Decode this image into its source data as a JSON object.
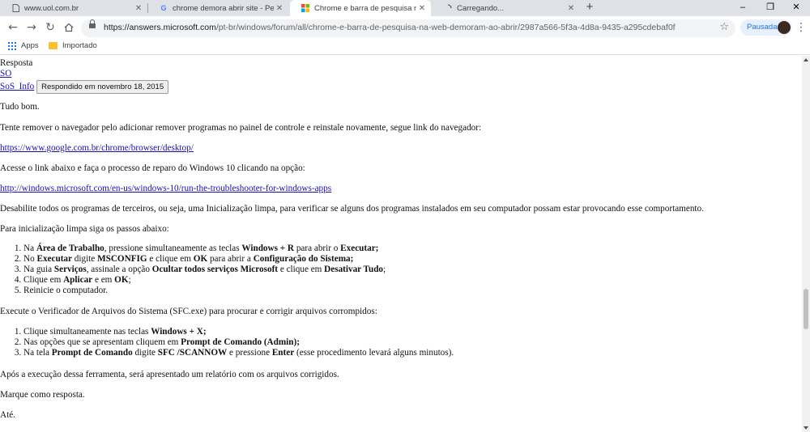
{
  "tabs": [
    {
      "title": "www.uol.com.br",
      "icon": "page-icon"
    },
    {
      "title": "chrome demora abrir site - Pesq",
      "icon": "google-icon"
    },
    {
      "title": "Chrome e barra de pesquisa na W",
      "icon": "microsoft-icon"
    },
    {
      "title": "Carregando...",
      "icon": "loading-icon"
    }
  ],
  "window_controls": {
    "minimize": "–",
    "restore": "❐",
    "close": "✕"
  },
  "toolbar": {
    "url_host": "https://answers.microsoft.com",
    "url_path": "/pt-br/windows/forum/all/chrome-e-barra-de-pesquisa-na-web-demoram-ao-abrir/2987a566-5f3a-4d8a-9435-a295cdebaf0f",
    "profile_label": "Pausada"
  },
  "bookmarks": [
    {
      "label": "Apps",
      "icon": "apps-icon"
    },
    {
      "label": "Importado",
      "icon": "folder-icon"
    }
  ],
  "post": {
    "header": "Resposta",
    "user_link": "SO",
    "user_name": "SoS_Info",
    "answered_button": "Respondido em novembro 18, 2015",
    "greeting": "Tudo bom.",
    "p1": "Tente remover o navegador pelo adicionar remover programas no painel de controle e reinstale novamente, segue link do navegador:",
    "link1": "https://www.google.com.br/chrome/browser/desktop/",
    "p2": "Acesse o link abaixo e faça o processo de reparo do Windows 10 clicando na opção:",
    "link2": "http://windows.microsoft.com/en-us/windows-10/run-the-troubleshooter-for-windows-apps",
    "p3": "Desabilite todos os programas de terceiros, ou seja, uma Inicialização limpa, para verificar se alguns dos programas instalados em seu computador possam estar provocando esse comportamento.",
    "p4": "Para inicialização limpa siga os passos abaixo:",
    "steps1": [
      {
        "a": "Na ",
        "b": "Área de Trabalho",
        "c": ", pressione simultaneamente as teclas ",
        "d": "Windows + R",
        "e": " para abrir o ",
        "f": "Executar;",
        "g": ""
      },
      {
        "a": "No ",
        "b": "Executar",
        "c": " digite ",
        "d": "MSCONFIG",
        "e": " e clique em ",
        "f": "OK",
        "g": " para abrir a ",
        "h": "Configuração do Sistema;"
      },
      {
        "a": "Na guia ",
        "b": "Serviços",
        "c": ", assinale a opção ",
        "d": "Ocultar todos serviços Microsoft",
        "e": " e clique em ",
        "f": "Desativar Tudo",
        "g": ";"
      },
      {
        "a": "Clique em ",
        "b": "Aplicar",
        "c": " e em ",
        "d": "OK",
        "e": ";"
      },
      {
        "a": "Reinicie o computador."
      }
    ],
    "p5": "Execute o Verificador de Arquivos do Sistema (SFC.exe) para procurar e corrigir arquivos corrompidos:",
    "steps2": [
      {
        "a": "Clique simultaneamente nas teclas ",
        "b": "Windows + X;"
      },
      {
        "a": "Nas opções que se apresentam cliquem em ",
        "b": "Prompt de Comando (Admin);"
      },
      {
        "a": "Na tela ",
        "b": "Prompt de Comando",
        "c": " digite ",
        "d": "SFC /SCANNOW",
        "e": " e pressione ",
        "f": "Enter",
        "g": " (esse procedimento levará alguns minutos)."
      }
    ],
    "p6": "Após a execução dessa ferramenta, será apresentado um relatório com os arquivos corrigidos.",
    "p7": "Marque como resposta.",
    "p8": "Até."
  }
}
